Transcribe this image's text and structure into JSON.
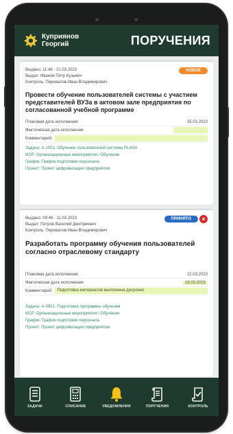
{
  "header": {
    "user_first_line": "Куприянов",
    "user_second_line": "Георгий",
    "title": "ПОРУЧЕНИЯ"
  },
  "tasks": [
    {
      "issued": "Выдано: 11:46 · 21.03.2023",
      "issued_by": "Выдал: Иванов Пётр Кузьмич",
      "control": "Контроль: Перевалов Иван Владимирович",
      "status": "НОВОЕ",
      "title": "Провести обучение пользователей системы с участием представителей ВУЗа в актовом зале предприятия по согласованной учебной программе",
      "planned_label": "Плановая дата исполнения:",
      "planned_value": "25.03.2023",
      "actual_label": "Фактическая дата исполнения:",
      "actual_value": "",
      "comment_label": "Комментарий:",
      "comment_value": "",
      "links": [
        "Задача: А-1003. Обучение пользователей системы PLANA",
        "ИСР: Организационные мероприятия / Обучение",
        "График: График подготовки персонала",
        "Проект: Проект цифровизации предприятия"
      ]
    },
    {
      "issued": "Выдано: 09:46 · 11.03.2023",
      "issued_by": "Выдал: Петров Василий Дмитриевич",
      "control": "Контроль: Перевалов Иван Владимирович",
      "status": "ПРИНЯТО",
      "close": "×",
      "title": "Разработать программу обучения пользователей согласно отраслевому стандарту",
      "planned_label": "Плановая дата исполнения:",
      "planned_value": "22.03.2023",
      "actual_label": "Фактическая дата исполнения:",
      "actual_value": "19.03.2023",
      "comment_label": "Комментарий:",
      "comment_value": "Подготовка материалов выполнена досрочно",
      "links": [
        "Задача: А-0901. Подготовка программы обучения",
        "ИСР: Организационные мероприятия / Обучение",
        "График: График подготовки персонала",
        "Проект: Проект цифровизации предприятия"
      ]
    }
  ],
  "nav": [
    {
      "label": "ЗАДАЧИ",
      "icon": "tasks-icon"
    },
    {
      "label": "СПИСАНИЕ",
      "icon": "write-off-icon"
    },
    {
      "label": "УВЕДОМЛЕНИЯ",
      "icon": "bell-icon"
    },
    {
      "label": "ПОРУЧЕНИЯ",
      "icon": "assignment-icon"
    },
    {
      "label": "КОНТРОЛЬ",
      "icon": "control-icon"
    }
  ],
  "colors": {
    "header_bg": "#1f3b30",
    "badge_new": "#f28a2a",
    "badge_accepted": "#2a6cc4",
    "close_red": "#d92727",
    "highlight": "#e9f7b6",
    "link": "#2f8a6c",
    "bell_active": "#f2c21a"
  }
}
